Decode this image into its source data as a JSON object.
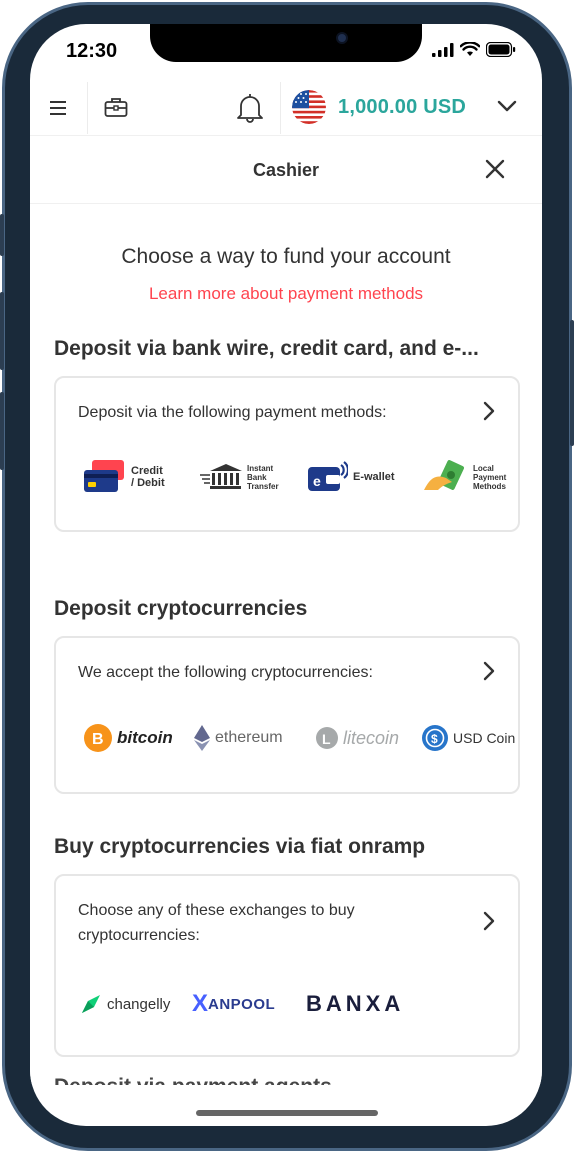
{
  "status_bar": {
    "time": "12:30"
  },
  "topbar": {
    "balance": "1,000.00 USD",
    "currency_flag": "us-flag-icon"
  },
  "header": {
    "title": "Cashier"
  },
  "intro": {
    "heading": "Choose a way to fund your account",
    "learn_more": "Learn more about payment methods"
  },
  "sections": {
    "bank": {
      "title": "Deposit via bank wire, credit card, and e-...",
      "description": "Deposit via the following payment methods:",
      "methods": {
        "credit_line1": "Credit",
        "credit_line2": "/ Debit",
        "transfer_line1": "Instant",
        "transfer_line2": "Bank",
        "transfer_line3": "Transfer",
        "ewallet": "E-wallet",
        "local_line1": "Local",
        "local_line2": "Payment",
        "local_line3": "Methods"
      }
    },
    "crypto": {
      "title": "Deposit cryptocurrencies",
      "description": "We accept the following cryptocurrencies:",
      "coins": {
        "bitcoin": "bitcoin",
        "ethereum": "ethereum",
        "litecoin": "litecoin",
        "usdcoin": "USD Coin"
      }
    },
    "fiat": {
      "title": "Buy cryptocurrencies via fiat onramp",
      "description": "Choose any of these exchanges to buy cryptocurrencies:",
      "exchanges": {
        "changelly": "changelly",
        "xanpool": "ANPOOL",
        "xanpool_x": "X",
        "banxa": "BANXA"
      }
    },
    "agents": {
      "title": "Deposit via payment agents"
    }
  },
  "colors": {
    "accent_teal": "#2ba69c",
    "link_red": "#ff444f",
    "frame_blue": "#1a2a3a"
  }
}
